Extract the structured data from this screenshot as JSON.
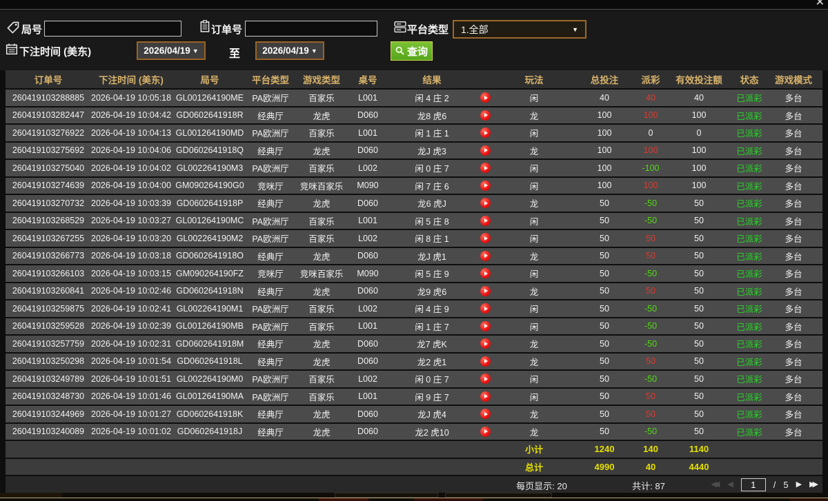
{
  "window": {
    "close_icon": "✕"
  },
  "colors": {
    "header_gold": "#d7b26b",
    "payout_win_red": "#e2382c",
    "payout_loss_green": "#50dc0e",
    "status_green": "#27d827",
    "summary_yellow": "#e5e000",
    "button_green": "#55a51a",
    "picker_border_brown": "#9a6424"
  },
  "filters": {
    "round_label": "局号",
    "round_value": "",
    "order_label": "订单号",
    "order_value": "",
    "platform_label": "平台类型",
    "platform_value": "1.全部",
    "caret_icon": "▼",
    "bet_time_label": "下注时间 (美东)",
    "date_from": "2026/04/19",
    "to_label": "至",
    "date_to": "2026/04/19",
    "search_label": "查询"
  },
  "table": {
    "columns": [
      "订单号",
      "下注时间 (美东)",
      "局号",
      "平台类型",
      "游戏类型",
      "桌号",
      "结果",
      "玩法",
      "总投注",
      "派彩",
      "有效投注额",
      "状态",
      "游戏模式"
    ],
    "rows": [
      {
        "order": "260419103288885",
        "time": "2026-04-19 10:05:18",
        "round": "GL001264190ME",
        "platform": "PA欧洲厅",
        "game": "百家乐",
        "table": "L001",
        "result": "闲 4 庄 2",
        "play": "闲",
        "bet": "40",
        "payout": "40",
        "payout_sign": "pos",
        "valid": "40",
        "status": "已派彩",
        "mode": "多台"
      },
      {
        "order": "260419103282447",
        "time": "2026-04-19 10:04:42",
        "round": "GD0602641918R",
        "platform": "经典厅",
        "game": "龙虎",
        "table": "D060",
        "result": "龙8 虎6",
        "play": "龙",
        "bet": "100",
        "payout": "100",
        "payout_sign": "pos",
        "valid": "100",
        "status": "已派彩",
        "mode": "多台"
      },
      {
        "order": "260419103276922",
        "time": "2026-04-19 10:04:13",
        "round": "GL001264190MD",
        "platform": "PA欧洲厅",
        "game": "百家乐",
        "table": "L001",
        "result": "闲 1 庄 1",
        "play": "闲",
        "bet": "100",
        "payout": "0",
        "payout_sign": "zero",
        "valid": "0",
        "status": "已派彩",
        "mode": "多台"
      },
      {
        "order": "260419103275692",
        "time": "2026-04-19 10:04:06",
        "round": "GD0602641918Q",
        "platform": "经典厅",
        "game": "龙虎",
        "table": "D060",
        "result": "龙J 虎3",
        "play": "龙",
        "bet": "100",
        "payout": "100",
        "payout_sign": "pos",
        "valid": "100",
        "status": "已派彩",
        "mode": "多台"
      },
      {
        "order": "260419103275040",
        "time": "2026-04-19 10:04:02",
        "round": "GL002264190M3",
        "platform": "PA欧洲厅",
        "game": "百家乐",
        "table": "L002",
        "result": "闲 0 庄 7",
        "play": "闲",
        "bet": "100",
        "payout": "-100",
        "payout_sign": "neg",
        "valid": "100",
        "status": "已派彩",
        "mode": "多台"
      },
      {
        "order": "260419103274639",
        "time": "2026-04-19 10:04:00",
        "round": "GM090264190G0",
        "platform": "竞咪厅",
        "game": "竞咪百家乐",
        "table": "M090",
        "result": "闲 7 庄 6",
        "play": "闲",
        "bet": "100",
        "payout": "100",
        "payout_sign": "pos",
        "valid": "100",
        "status": "已派彩",
        "mode": "多台"
      },
      {
        "order": "260419103270732",
        "time": "2026-04-19 10:03:39",
        "round": "GD0602641918P",
        "platform": "经典厅",
        "game": "龙虎",
        "table": "D060",
        "result": "龙6 虎J",
        "play": "龙",
        "bet": "50",
        "payout": "-50",
        "payout_sign": "neg",
        "valid": "50",
        "status": "已派彩",
        "mode": "多台"
      },
      {
        "order": "260419103268529",
        "time": "2026-04-19 10:03:27",
        "round": "GL001264190MC",
        "platform": "PA欧洲厅",
        "game": "百家乐",
        "table": "L001",
        "result": "闲 5 庄 8",
        "play": "闲",
        "bet": "50",
        "payout": "-50",
        "payout_sign": "neg",
        "valid": "50",
        "status": "已派彩",
        "mode": "多台"
      },
      {
        "order": "260419103267255",
        "time": "2026-04-19 10:03:20",
        "round": "GL002264190M2",
        "platform": "PA欧洲厅",
        "game": "百家乐",
        "table": "L002",
        "result": "闲 8 庄 1",
        "play": "闲",
        "bet": "50",
        "payout": "50",
        "payout_sign": "pos",
        "valid": "50",
        "status": "已派彩",
        "mode": "多台"
      },
      {
        "order": "260419103266773",
        "time": "2026-04-19 10:03:18",
        "round": "GD0602641918O",
        "platform": "经典厅",
        "game": "龙虎",
        "table": "D060",
        "result": "龙J 虎1",
        "play": "龙",
        "bet": "50",
        "payout": "50",
        "payout_sign": "pos",
        "valid": "50",
        "status": "已派彩",
        "mode": "多台"
      },
      {
        "order": "260419103266103",
        "time": "2026-04-19 10:03:15",
        "round": "GM090264190FZ",
        "platform": "竞咪厅",
        "game": "竞咪百家乐",
        "table": "M090",
        "result": "闲 5 庄 9",
        "play": "闲",
        "bet": "50",
        "payout": "-50",
        "payout_sign": "neg",
        "valid": "50",
        "status": "已派彩",
        "mode": "多台"
      },
      {
        "order": "260419103260841",
        "time": "2026-04-19 10:02:46",
        "round": "GD0602641918N",
        "platform": "经典厅",
        "game": "龙虎",
        "table": "D060",
        "result": "龙9 虎6",
        "play": "龙",
        "bet": "50",
        "payout": "50",
        "payout_sign": "pos",
        "valid": "50",
        "status": "已派彩",
        "mode": "多台"
      },
      {
        "order": "260419103259875",
        "time": "2026-04-19 10:02:41",
        "round": "GL002264190M1",
        "platform": "PA欧洲厅",
        "game": "百家乐",
        "table": "L002",
        "result": "闲 4 庄 9",
        "play": "闲",
        "bet": "50",
        "payout": "-50",
        "payout_sign": "neg",
        "valid": "50",
        "status": "已派彩",
        "mode": "多台"
      },
      {
        "order": "260419103259528",
        "time": "2026-04-19 10:02:39",
        "round": "GL001264190MB",
        "platform": "PA欧洲厅",
        "game": "百家乐",
        "table": "L001",
        "result": "闲 1 庄 7",
        "play": "闲",
        "bet": "50",
        "payout": "-50",
        "payout_sign": "neg",
        "valid": "50",
        "status": "已派彩",
        "mode": "多台"
      },
      {
        "order": "260419103257759",
        "time": "2026-04-19 10:02:31",
        "round": "GD0602641918M",
        "platform": "经典厅",
        "game": "龙虎",
        "table": "D060",
        "result": "龙7 虎K",
        "play": "龙",
        "bet": "50",
        "payout": "-50",
        "payout_sign": "neg",
        "valid": "50",
        "status": "已派彩",
        "mode": "多台"
      },
      {
        "order": "260419103250298",
        "time": "2026-04-19 10:01:54",
        "round": "GD0602641918L",
        "platform": "经典厅",
        "game": "龙虎",
        "table": "D060",
        "result": "龙2 虎1",
        "play": "龙",
        "bet": "50",
        "payout": "50",
        "payout_sign": "pos",
        "valid": "50",
        "status": "已派彩",
        "mode": "多台"
      },
      {
        "order": "260419103249789",
        "time": "2026-04-19 10:01:51",
        "round": "GL002264190M0",
        "platform": "PA欧洲厅",
        "game": "百家乐",
        "table": "L002",
        "result": "闲 0 庄 7",
        "play": "闲",
        "bet": "50",
        "payout": "-50",
        "payout_sign": "neg",
        "valid": "50",
        "status": "已派彩",
        "mode": "多台"
      },
      {
        "order": "260419103248730",
        "time": "2026-04-19 10:01:46",
        "round": "GL001264190MA",
        "platform": "PA欧洲厅",
        "game": "百家乐",
        "table": "L001",
        "result": "闲 9 庄 7",
        "play": "闲",
        "bet": "50",
        "payout": "50",
        "payout_sign": "pos",
        "valid": "50",
        "status": "已派彩",
        "mode": "多台"
      },
      {
        "order": "260419103244969",
        "time": "2026-04-19 10:01:27",
        "round": "GD0602641918K",
        "platform": "经典厅",
        "game": "龙虎",
        "table": "D060",
        "result": "龙J 虎4",
        "play": "龙",
        "bet": "50",
        "payout": "50",
        "payout_sign": "pos",
        "valid": "50",
        "status": "已派彩",
        "mode": "多台"
      },
      {
        "order": "260419103240089",
        "time": "2026-04-19 10:01:02",
        "round": "GD0602641918J",
        "platform": "经典厅",
        "game": "龙虎",
        "table": "D060",
        "result": "龙2 虎10",
        "play": "龙",
        "bet": "50",
        "payout": "-50",
        "payout_sign": "neg",
        "valid": "50",
        "status": "已派彩",
        "mode": "多台"
      }
    ],
    "subtotal": {
      "label": "小计",
      "bet": "1240",
      "payout": "140",
      "valid": "1140"
    },
    "total": {
      "label": "总计",
      "bet": "4990",
      "payout": "40",
      "valid": "4440"
    }
  },
  "pagination": {
    "per_page": "每页显示: 20",
    "total_count": "共计: 87",
    "first_icon": "◀◀",
    "prev_icon": "◀",
    "page_value": "1",
    "separator": "/",
    "page_count": "5",
    "next_icon": "▶",
    "last_icon": "▶▶"
  }
}
